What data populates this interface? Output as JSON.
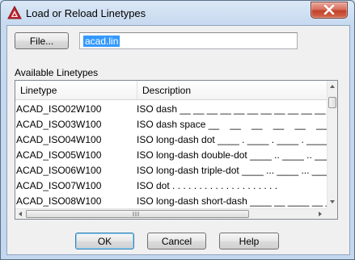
{
  "window": {
    "title": "Load or Reload Linetypes",
    "app_icon": "autocad-icon",
    "close_icon": "close-icon"
  },
  "file": {
    "button_label": "File...",
    "filename": "acad.lin"
  },
  "linetypes": {
    "section_label": "Available Linetypes",
    "columns": [
      "Linetype",
      "Description"
    ],
    "rows": [
      {
        "name": "ACAD_ISO02W100",
        "description": "ISO dash __ __ __ __ __ __ __ __ __ __ __ __ __"
      },
      {
        "name": "ACAD_ISO03W100",
        "description": "ISO dash space __    __    __    __    __    __"
      },
      {
        "name": "ACAD_ISO04W100",
        "description": "ISO long-dash dot ____ . ____ . ____ . ____ . _"
      },
      {
        "name": "ACAD_ISO05W100",
        "description": "ISO long-dash double-dot ____ .. ____ .. ____ ."
      },
      {
        "name": "ACAD_ISO06W100",
        "description": "ISO long-dash triple-dot ____ ... ____ ... ____"
      },
      {
        "name": "ACAD_ISO07W100",
        "description": "ISO dot . . . . . . . . . . . . . . . . . . . ."
      },
      {
        "name": "ACAD_ISO08W100",
        "description": "ISO long-dash short-dash ____ __ ____ __ ____ _"
      }
    ]
  },
  "buttons": {
    "ok": "OK",
    "cancel": "Cancel",
    "help": "Help"
  },
  "colors": {
    "selection": "#3399ff",
    "close_button": "#c2412b",
    "window_frame": "#c4d7ee"
  }
}
